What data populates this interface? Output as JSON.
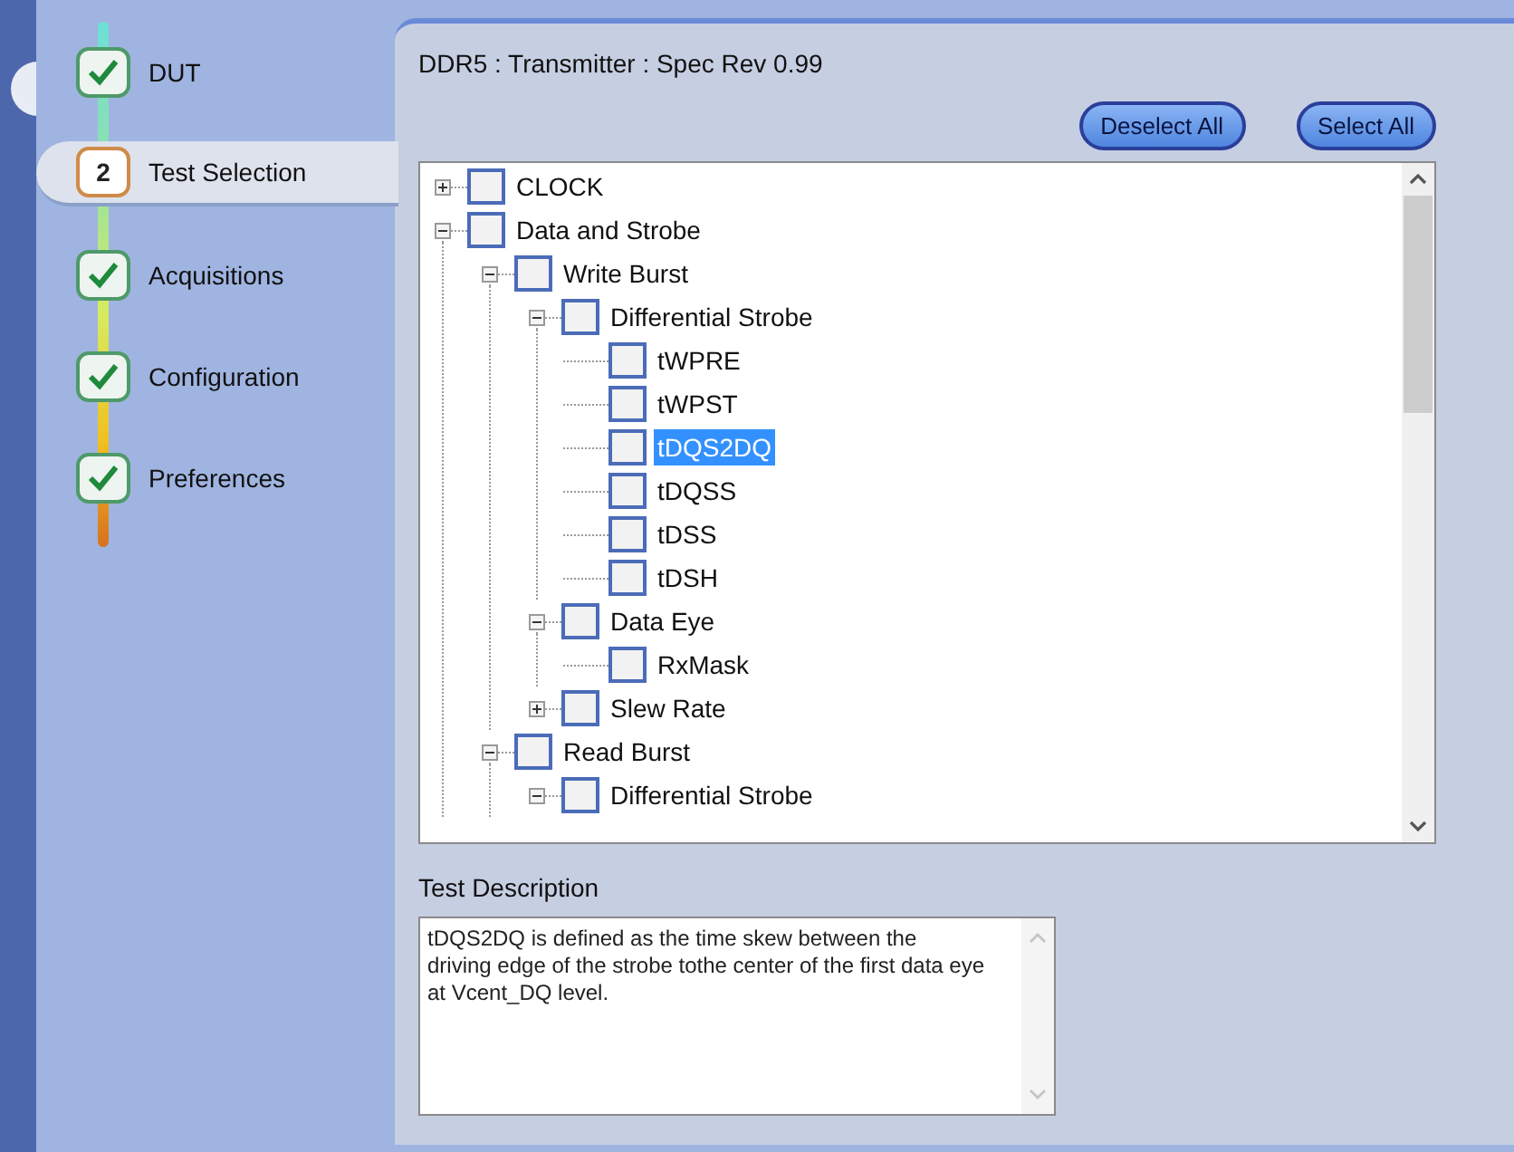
{
  "steps": [
    {
      "label": "DUT",
      "kind": "done",
      "selected": false
    },
    {
      "label": "Test Selection",
      "kind": "number",
      "number": "2",
      "selected": true
    },
    {
      "label": "Acquisitions",
      "kind": "done",
      "selected": false
    },
    {
      "label": "Configuration",
      "kind": "done",
      "selected": false
    },
    {
      "label": "Preferences",
      "kind": "done",
      "selected": false
    }
  ],
  "header": {
    "title": "DDR5 : Transmitter : Spec Rev 0.99"
  },
  "buttons": [
    "Deselect All",
    "Select All"
  ],
  "tree": [
    {
      "label": "CLOCK",
      "expanded": false,
      "checked": false,
      "selected": false
    },
    {
      "label": "Data and Strobe",
      "expanded": true,
      "checked": false,
      "selected": false,
      "children": [
        {
          "label": "Write Burst",
          "expanded": true,
          "checked": false,
          "selected": false,
          "children": [
            {
              "label": "Differential Strobe",
              "expanded": true,
              "checked": false,
              "selected": false,
              "children": [
                {
                  "label": "tWPRE",
                  "checked": false,
                  "selected": false
                },
                {
                  "label": "tWPST",
                  "checked": false,
                  "selected": false
                },
                {
                  "label": "tDQS2DQ",
                  "checked": false,
                  "selected": true
                },
                {
                  "label": "tDQSS",
                  "checked": false,
                  "selected": false
                },
                {
                  "label": "tDSS",
                  "checked": false,
                  "selected": false
                },
                {
                  "label": "tDSH",
                  "checked": false,
                  "selected": false
                }
              ]
            },
            {
              "label": "Data Eye",
              "expanded": true,
              "checked": false,
              "selected": false,
              "children": [
                {
                  "label": "RxMask",
                  "checked": false,
                  "selected": false
                }
              ]
            },
            {
              "label": "Slew Rate",
              "expanded": false,
              "checked": false,
              "selected": false
            }
          ]
        },
        {
          "label": "Read Burst",
          "expanded": true,
          "checked": false,
          "selected": false,
          "children": [
            {
              "label": "Differential Strobe",
              "expanded": true,
              "checked": false,
              "selected": false
            }
          ]
        }
      ]
    }
  ],
  "description": {
    "label": "Test Description",
    "text": "tDQS2DQ is defined as the time skew between the driving edge of the strobe tothe center of the first data eye at Vcent_DQ level."
  }
}
